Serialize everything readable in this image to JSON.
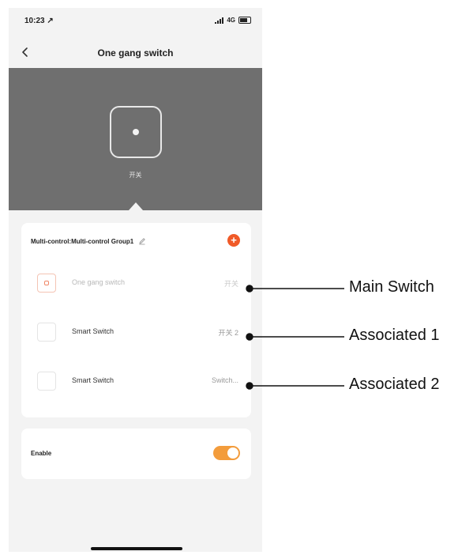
{
  "status_bar": {
    "time": "10:23 ↗",
    "network": "4G"
  },
  "nav": {
    "title": "One gang switch",
    "back_icon": "chevron-left-icon"
  },
  "hero": {
    "device_label": "开关"
  },
  "group": {
    "name": "Multi-control:Multi-control Group1",
    "add_icon": "plus-icon",
    "edit_icon": "pencil-icon",
    "add_color": "#f05a28",
    "rows": [
      {
        "name": "One gang switch",
        "value": "开关"
      },
      {
        "name": "Smart Switch",
        "value": "开关 2"
      },
      {
        "name": "Smart Switch",
        "value": "Switch..."
      }
    ]
  },
  "enable": {
    "label": "Enable",
    "on": true,
    "toggle_color": "#f39c3c"
  },
  "callouts": {
    "main": "Main Switch",
    "assoc1": "Associated 1",
    "assoc2": "Associated 2"
  }
}
